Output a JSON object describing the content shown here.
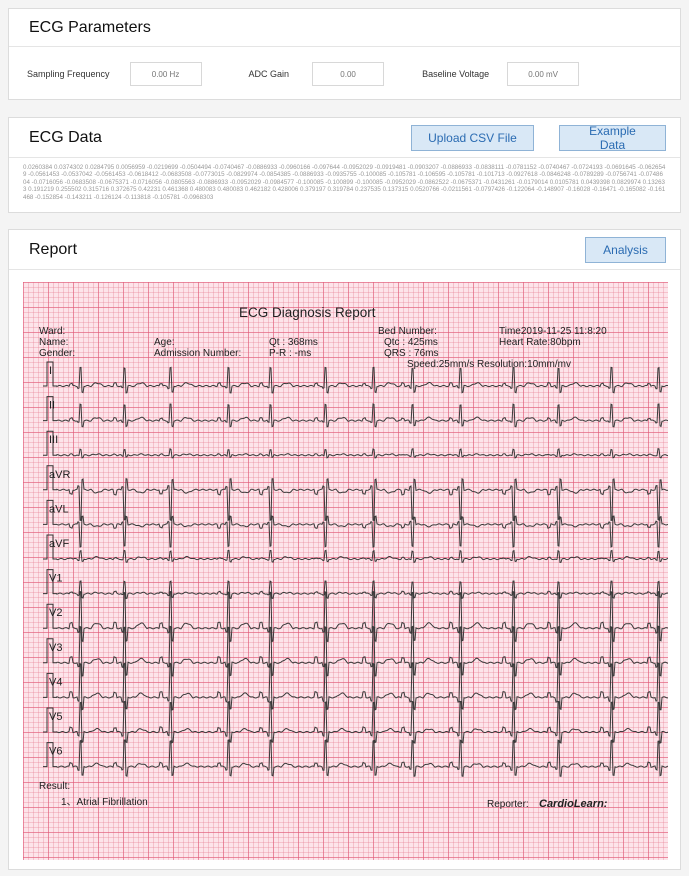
{
  "params": {
    "title": "ECG Parameters",
    "fields": [
      {
        "label": "Sampling Frequency",
        "value": "0.00 Hz"
      },
      {
        "label": "ADC Gain",
        "value": "0.00"
      },
      {
        "label": "Baseline Voltage",
        "value": "0.00 mV"
      }
    ]
  },
  "data": {
    "title": "ECG Data",
    "upload_label": "Upload CSV File",
    "example_label": "Example Data",
    "text": "0.0260384 0.0374302 0.0284795 0.0056959 -0.0219699 -0.0504494 -0.0740467 -0.0886933 -0.0960166 -0.097644 -0.0952029 -0.0919481 -0.0903207 -0.0886933 -0.0838111 -0.0781152 -0.0740467 -0.0724193 -0.0691645 -0.0626549 -0.0561453 -0.0537042 -0.0561453 -0.0618412 -0.0683508 -0.0773015 -0.0829974 -0.0854385 -0.0886933 -0.0935755 -0.100085 -0.105781 -0.106595 -0.105781 -0.101713 -0.0927618 -0.0846248 -0.0789289 -0.0756741 -0.0748604 -0.0716056 -0.0683508 -0.0675371 -0.0716056 -0.0805563 -0.0886933 -0.0952029 -0.0984577 -0.100085 -0.100899 -0.100085 -0.0952029 -0.0862522 -0.0675371 -0.0431261 -0.0179014 0.0105781 0.0439398 0.0829974 0.132633 0.191219 0.255502 0.315716 0.372675 0.42231 0.461368 0.480083 0.480083 0.462182 0.428006 0.379197 0.319784 0.237535 0.137315 0.0520766 -0.0211561 -0.0797426 -0.122064 -0.148907 -0.16028 -0.16471 -0.165082 -0.161468 -0.152854 -0.143211 -0.126124 -0.113818 -0.105781 -0.0968303"
  },
  "report": {
    "title": "Report",
    "analysis_label": "Analysis",
    "doc_title": "ECG Diagnosis Report",
    "ward": "Ward:",
    "name": "Name:",
    "gender": "Gender:",
    "age": "Age:",
    "admission": "Admission Number:",
    "qt": "Qt : 368ms",
    "pr": "P-R : -ms",
    "bed": "Bed Number:",
    "qtc": "Qtc : 425ms",
    "qrs": "QRS : 76ms",
    "time": "Time2019-11-25 11:8:20",
    "hr": "Heart Rate:80bpm",
    "speed": "Speed:25mm/s Resolution:10mm/mv",
    "result_label": "Result:",
    "result_item": "1、Atrial Fibrillation",
    "reporter_label": "Reporter:",
    "reporter_name": "CardioLearn:",
    "leads": [
      "I",
      "II",
      "III",
      "aVR",
      "aVL",
      "aVF",
      "V1",
      "V2",
      "V3",
      "V4",
      "V5",
      "V6"
    ]
  }
}
